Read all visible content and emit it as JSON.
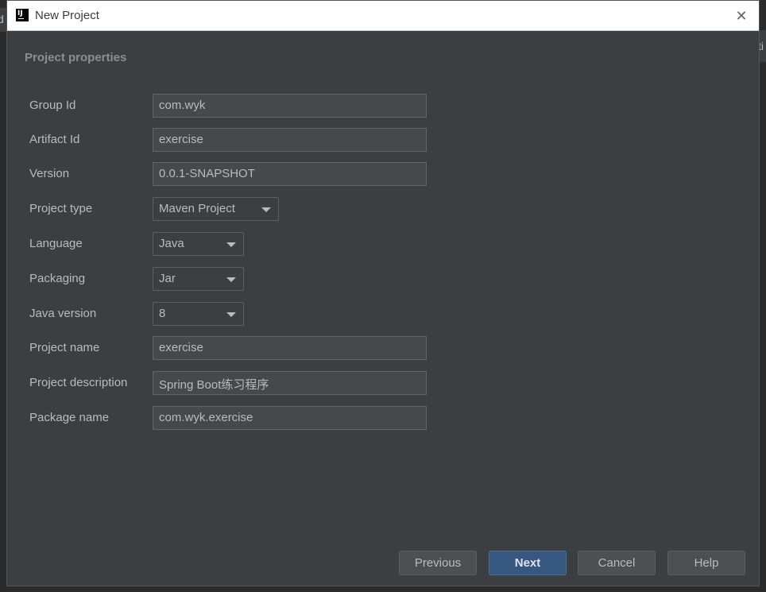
{
  "dialog": {
    "title": "New Project",
    "section_title": "Project properties"
  },
  "background": {
    "left_fragment": "d",
    "right_fragment": "ti"
  },
  "fields": {
    "group_id": {
      "label": "Group Id",
      "value": "com.wyk"
    },
    "artifact_id": {
      "label": "Artifact Id",
      "value": "exercise"
    },
    "version": {
      "label": "Version",
      "value": "0.0.1-SNAPSHOT"
    },
    "project_type": {
      "label": "Project type",
      "value": "Maven Project"
    },
    "language": {
      "label": "Language",
      "value": "Java"
    },
    "packaging": {
      "label": "Packaging",
      "value": "Jar"
    },
    "java_version": {
      "label": "Java version",
      "value": "8"
    },
    "project_name": {
      "label": "Project name",
      "value": "exercise"
    },
    "project_description": {
      "label": "Project description",
      "value": "Spring Boot练习程序"
    },
    "package_name": {
      "label": "Package name",
      "value": "com.wyk.exercise"
    }
  },
  "buttons": {
    "previous": "Previous",
    "next": "Next",
    "cancel": "Cancel",
    "help": "Help"
  },
  "icons": {
    "app": "intellij-idea-icon",
    "close": "close-icon",
    "dropdown": "chevron-down-icon"
  },
  "colors": {
    "dialog_bg": "#3c3f41",
    "field_bg": "#45494a",
    "primary_button": "#365880",
    "text": "#bbbbbb"
  }
}
